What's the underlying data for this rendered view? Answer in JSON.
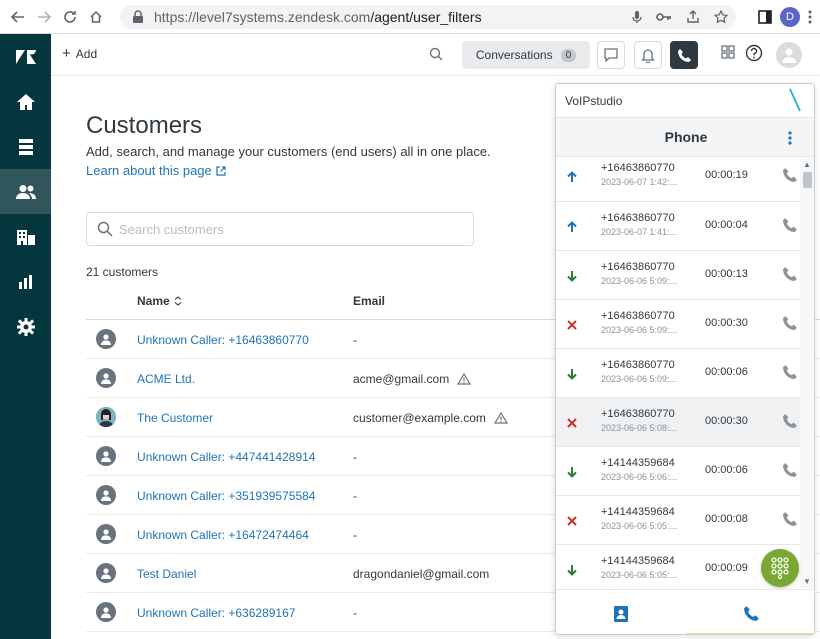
{
  "browser": {
    "url_host": "https://level7systems.zendesk.com",
    "url_path": "/agent/user_filters",
    "profile_initial": "D"
  },
  "topbar": {
    "add_label": "Add",
    "conversations_label": "Conversations",
    "conversations_count": "0"
  },
  "page": {
    "title": "Customers",
    "description": "Add, search, and manage your customers (end users) all in one place.",
    "learn_link": "Learn about this page",
    "search_placeholder": "Search customers",
    "count": "21 customers"
  },
  "table": {
    "headers": {
      "name": "Name",
      "email": "Email"
    },
    "rows": [
      {
        "name": "Unknown Caller: +16463860770",
        "email": "-",
        "warn": false,
        "photo": false
      },
      {
        "name": "ACME Ltd.",
        "email": "acme@gmail.com",
        "warn": true,
        "photo": false
      },
      {
        "name": "The Customer",
        "email": "customer@example.com",
        "warn": true,
        "photo": true
      },
      {
        "name": "Unknown Caller: +447441428914",
        "email": "-",
        "warn": false,
        "photo": false
      },
      {
        "name": "Unknown Caller: +351939575584",
        "email": "-",
        "warn": false,
        "photo": false
      },
      {
        "name": "Unknown Caller: +16472474464",
        "email": "-",
        "warn": false,
        "photo": false
      },
      {
        "name": "Test Daniel",
        "email": "dragondaniel@gmail.com",
        "warn": false,
        "photo": false
      },
      {
        "name": "Unknown Caller: +636289167",
        "email": "-",
        "warn": false,
        "photo": false
      }
    ]
  },
  "voip": {
    "app_title": "VoIPstudio",
    "header_title": "Phone",
    "calls": [
      {
        "direction": "outgoing",
        "number": "+16463860770",
        "time": "2023-06-07 1:42:...",
        "duration": "00:00:19"
      },
      {
        "direction": "outgoing",
        "number": "+16463860770",
        "time": "2023-06-07 1:41:...",
        "duration": "00:00:04"
      },
      {
        "direction": "incoming",
        "number": "+16463860770",
        "time": "2023-06-06 5:09:...",
        "duration": "00:00:13"
      },
      {
        "direction": "missed",
        "number": "+16463860770",
        "time": "2023-06-06 5:09:...",
        "duration": "00:00:30"
      },
      {
        "direction": "incoming",
        "number": "+16463860770",
        "time": "2023-06-06 5:09:...",
        "duration": "00:00:06"
      },
      {
        "direction": "missed",
        "number": "+16463860770",
        "time": "2023-06-06 5:08:...",
        "duration": "00:00:30"
      },
      {
        "direction": "incoming",
        "number": "+14144359684",
        "time": "2023-06-06 5:06:...",
        "duration": "00:00:06"
      },
      {
        "direction": "missed",
        "number": "+14144359684",
        "time": "2023-06-06 5:05:...",
        "duration": "00:00:08"
      },
      {
        "direction": "incoming",
        "number": "+14144359684",
        "time": "2023-06-06 5:05:...",
        "duration": "00:00:09"
      }
    ]
  },
  "colors": {
    "sidebar": "#03363d",
    "link": "#1f73b7",
    "outgoing": "#1f73b7",
    "incoming": "#2e7d32",
    "missed": "#d32f2f",
    "dialpad": "#78a832"
  }
}
